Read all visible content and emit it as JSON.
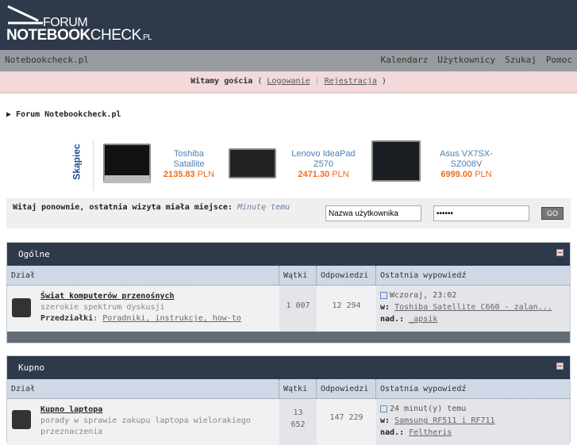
{
  "logo": {
    "line1": "FORUM",
    "bold": "NOTEBOOK",
    "rest": "CHECK",
    "tld": ".PL"
  },
  "nav": {
    "site": "Notebookcheck.pl",
    "links": [
      "Kalendarz",
      "Użytkownicy",
      "Szukaj",
      "Pomoc"
    ]
  },
  "welcome": {
    "text": "Witamy gościa",
    "open": " ( ",
    "login": "Logowanie",
    "sep": " | ",
    "register": "Rejestracja",
    "close": " )"
  },
  "breadcrumb": "▶ Forum Notebookcheck.pl",
  "ads": {
    "brand": "Skąpiec",
    "products": [
      {
        "name": "Toshiba Satallite",
        "price": "2135.83",
        "currency": " PLN"
      },
      {
        "name": "Lenovo IdeaPad Z570",
        "price": "2471.30",
        "currency": " PLN"
      },
      {
        "name": "Asus VX7SX-SZ008V",
        "price": "6999.00",
        "currency": " PLN"
      }
    ]
  },
  "login": {
    "message": "Witaj ponownie, ostatnia wizyta miała miejsce: ",
    "when": "Minutę temu",
    "username": "Nazwa użytkownika",
    "password": "••••••",
    "go": "GO"
  },
  "columns": [
    "Dział",
    "Wątki",
    "Odpowiedzi",
    "Ostatnia wypowiedź"
  ],
  "sections": [
    {
      "title": "Ogólne",
      "forum": {
        "title": "Świat komputerów przenośnych",
        "desc": "szerokie spektrum dyskusji",
        "sub_label": "Przedziałki",
        "sub": "Poradniki, instrukcje, how-to",
        "threads": "1 007",
        "posts": "12 294",
        "last_time": "Wczoraj, 23:02",
        "in_label": "w:",
        "last_thread": "Toshiba Satellite C660 - zalan...",
        "by_label": "nad.:",
        "last_user": "_apsik"
      }
    },
    {
      "title": "Kupno",
      "forum": {
        "title": "Kupno laptopa",
        "desc": "porady w sprawie zakupu laptopa wielorakiego przeznaczenia",
        "threads": "13 652",
        "posts": "147 229",
        "last_time": "24 minut(y) temu",
        "in_label": "w:",
        "last_thread": "Samsung RF511 i RF711",
        "by_label": "nad.:",
        "last_user": "Feltheris"
      }
    }
  ]
}
